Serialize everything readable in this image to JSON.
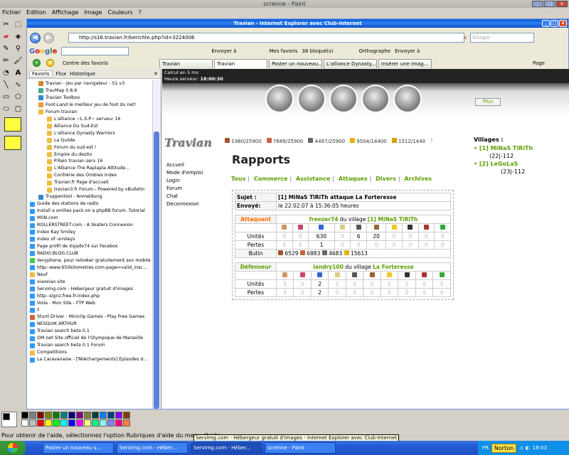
{
  "paint": {
    "title": "screnne - Paint",
    "menu": [
      "Fichier",
      "Edition",
      "Affichage",
      "Image",
      "Couleurs",
      "?"
    ],
    "status": "Pour obtenir de l'aide, sélectionnez l'option Rubriques d'aide du menu d'aide.",
    "tooltip": "Servimg.com - Hébergeur gratuit d'images - Internet Explorer avec Club-Internet"
  },
  "ie": {
    "title": "Travian - Internet Explorer avec Club-Internet",
    "address": "http://s16.travian.fr/berichte.php?id=3224006",
    "search_placeholder": "Google",
    "google_items": [
      "Envoyer à",
      "Mes favoris",
      "38 bloqué(s)",
      "Orthographe",
      "Envoyer à"
    ],
    "centre": "Centre des favoris",
    "tabs": [
      "Travian",
      "Travian",
      "Poster un nouveau...",
      "L'alliance Dynasty...",
      "Insérer une imag..."
    ],
    "page_menu": "Page"
  },
  "sidebar": {
    "tabs": [
      "Favoris",
      "Flux",
      "Historique"
    ],
    "items": [
      "Travian - Jeu par navigateur - S1 v3",
      "TravMap 0.8.6",
      "Travian Toolbox",
      "Foot-Land le meilleur jeu de foot du net!",
      "Forum travian",
      "L'alliance ~L.S.P~ serveur 16",
      "Alliance Du Sud-Est",
      "L'alliance Dynasty Warriors",
      "La Guilde",
      "Forum du sud est !",
      "Empire du destin",
      "P.Rain travian serv 16",
      "L'Alliance The Raplapla Attitude...",
      "Confrérie des Ombres Index",
      "Travian.fr Page d'accueil",
      "travian3.fr Forum - Powered by vBulletin",
      "Truppentool - Anmeldung",
      "Guide des stations de radio",
      "Install a smilies pack on a phpBB forum. Tutorial",
      "MSN.com",
      "ROLLERSTREET.com - A Skaters Connexion",
      "Index Kay Smiley",
      "Index of -smileys",
      "Page profil de Xsjado74 sur Facebox",
      "RADIO.BLOG.CLUB",
      "Veryphone, pour relooker gratuitement son mobile",
      "http--www.650kilometres.com-page=valid_insc...",
      "Neuf",
      "xiaoxiao site",
      "Servimg.com - Hébergeur gratuit d'images",
      "http--signz.free.fr-index.php",
      "Voila - Mon Site - FTP Web",
      "z",
      "Stunt Driver - Miniclip Games - Play Free Games",
      "NESQUIK ARTHUR",
      "Travian search beta 0.1",
      "OM.net Site officiel de l'Olympique de Marseille",
      "Travian search beta 0.1 Forum",
      "Competitions",
      "La Caravanaise - [Téléchargements] Episodes d..."
    ]
  },
  "page": {
    "calc": "Calcul en 5 ms",
    "server_label": "Heure serveur:",
    "server_time": "18:00:30",
    "plus": "Plus",
    "logo": "Travian",
    "nav": [
      "Accueil",
      "Mode d'emploi",
      "Login",
      "Forum",
      "Chat",
      "Deconnexion"
    ],
    "resources": [
      "1980/25900",
      "7689/25900",
      "4497/25900",
      "9504/14400",
      "1512/1440"
    ],
    "heading": "Rapports",
    "filters": [
      "Tous",
      "Commerce",
      "Assistance",
      "Attaques",
      "Divers",
      "Archives"
    ],
    "villages_label": "Villages :",
    "villages": [
      {
        "name": "• [1] MiNaS TiRiTh",
        "coords": "(22|-112"
      },
      {
        "name": "• [2] LeGoLaS",
        "coords": "(23|-112"
      }
    ],
    "report": {
      "subject_label": "Sujet :",
      "subject": "[1] MiNaS TiRiTh attaque La Forteresse",
      "sent_label": "Envoyé:",
      "sent": "le 22.02.07 à 15:36:05 heures",
      "attacker_label": "Attaquant",
      "attacker": "freezer74",
      "du_village": "du village",
      "attacker_village": "[1] MiNaS TiRiTh",
      "units_label": "Unités",
      "losses_label": "Pertes",
      "booty_label": "Butin",
      "att_units": [
        "0",
        "0",
        "630",
        "0",
        "6",
        "20",
        "0",
        "0",
        "0",
        "0"
      ],
      "att_losses": [
        "0",
        "0",
        "1",
        "0",
        "0",
        "0",
        "0",
        "0",
        "0",
        "0"
      ],
      "booty": [
        "6529",
        "6883",
        "4683",
        "15613"
      ],
      "defender_label": "Défenseur",
      "defender": "landry100",
      "defender_village": "La Forteresse",
      "def_units": [
        "0",
        "0",
        "2",
        "0",
        "0",
        "0",
        "0",
        "0",
        "0",
        "0"
      ],
      "def_losses": [
        "0",
        "0",
        "2",
        "0",
        "0",
        "0",
        "0",
        "0",
        "0",
        "0"
      ]
    }
  },
  "taskbar": {
    "buttons": [
      "Poster un nouveau s...",
      "Servimg.com - Héber...",
      "Servimg.com - Héber...",
      "screnne - Paint"
    ],
    "norton": "Norton",
    "lang": "FR",
    "time": "18:03"
  }
}
